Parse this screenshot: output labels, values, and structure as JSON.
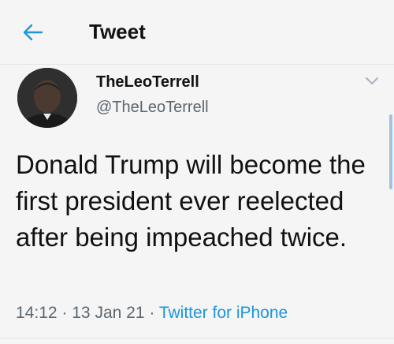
{
  "header": {
    "title": "Tweet",
    "back_icon": "arrow-left-icon",
    "accent_color": "#1b95e0"
  },
  "tweet": {
    "author": {
      "display_name": "TheLeoTerrell",
      "handle": "@TheLeoTerrell",
      "avatar": "profile-photo"
    },
    "text": "Donald Trump will become the first president ever reelected after being impeached twice.",
    "time": "14:12",
    "date": "13 Jan 21",
    "separator": "·",
    "source": "Twitter for iPhone",
    "menu_icon": "chevron-down-icon"
  }
}
